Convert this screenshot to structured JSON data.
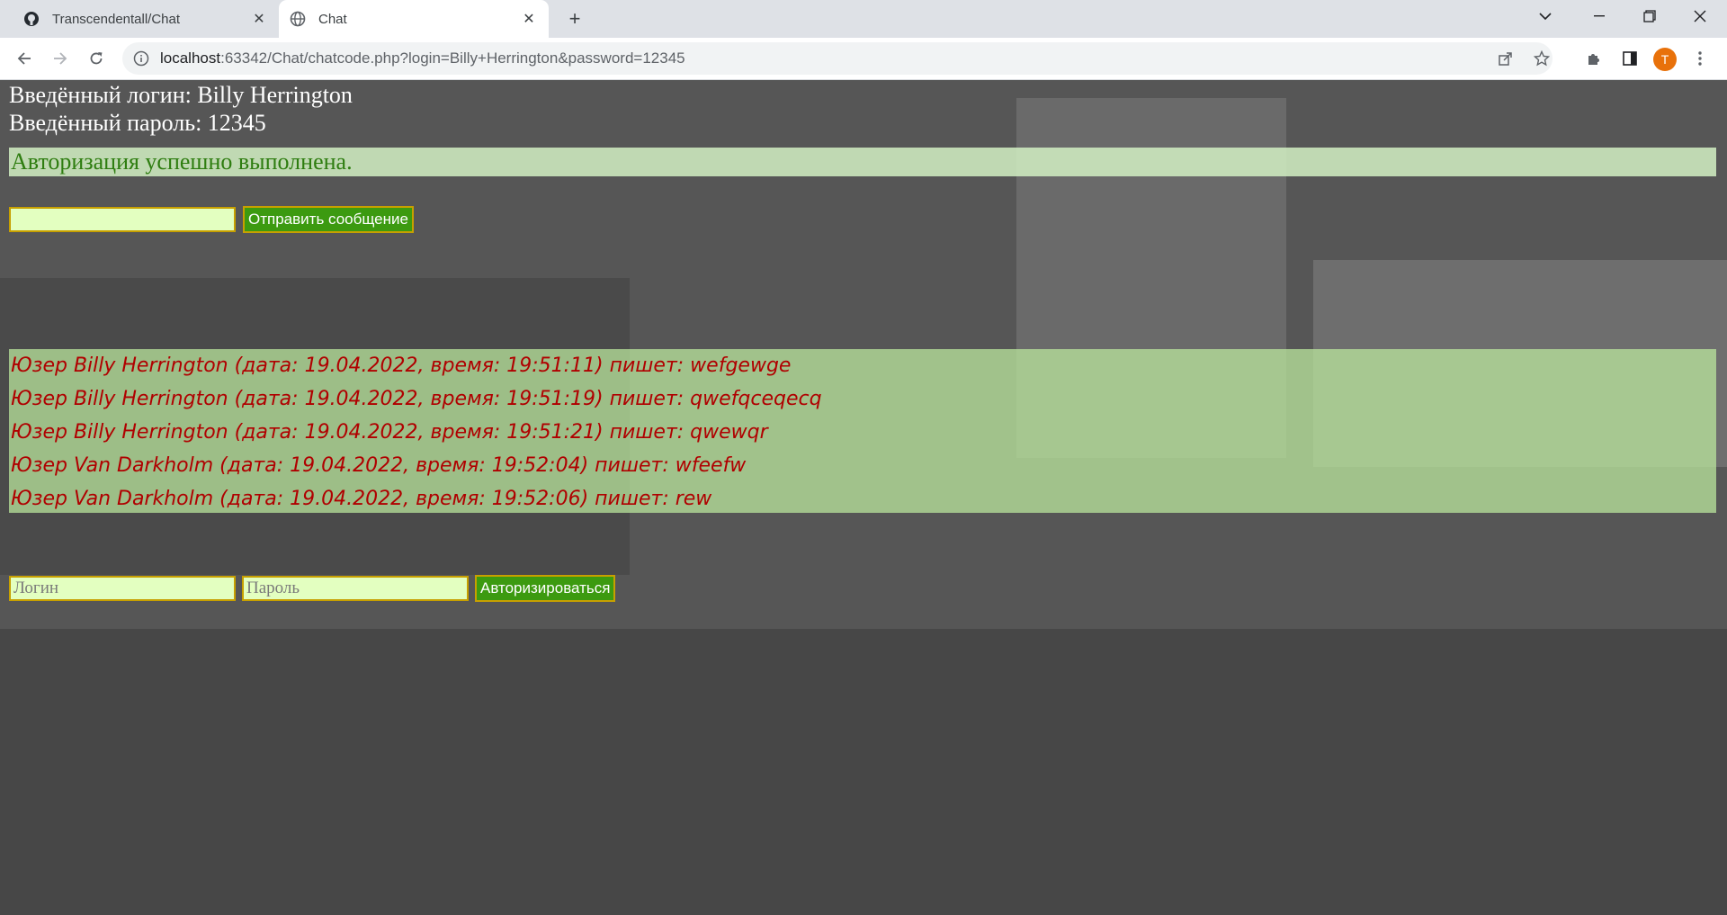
{
  "browser": {
    "tabs": [
      {
        "label": "Transcendentall/Chat",
        "icon": "github-icon",
        "active": false
      },
      {
        "label": "Chat",
        "icon": "globe-icon",
        "active": true
      }
    ],
    "url_host": "localhost",
    "url_rest": ":63342/Chat/chatcode.php?login=Billy+Herrington&password=12345",
    "profile_initial": "T",
    "colors": {
      "tabbar": "#dee1e6",
      "avatar": "#e8710a"
    }
  },
  "page": {
    "entered_login": "Введённый логин: Billy Herrington",
    "entered_password": "Введённый пароль: 12345",
    "auth_success": "Авторизация успешно выполнена.",
    "message_form": {
      "value": "",
      "send_label": "Отправить сообщение"
    },
    "messages": [
      "Юзер Billy Herrington (дата: 19.04.2022, время: 19:51:11) пишет: wefgewge",
      "Юзер Billy Herrington (дата: 19.04.2022, время: 19:51:19) пишет: qwefqceqecq",
      "Юзер Billy Herrington (дата: 19.04.2022, время: 19:51:21) пишет: qwewqr",
      "Юзер Van Darkholm (дата: 19.04.2022, время: 19:52:04) пишет: wfeefw",
      "Юзер Van Darkholm (дата: 19.04.2022, время: 19:52:06) пишет: rew"
    ],
    "login_form": {
      "login_placeholder": "Логин",
      "password_placeholder": "Пароль",
      "submit_label": "Авторизироваться"
    },
    "colors": {
      "success_text": "#2e7d10",
      "message_text": "#b00000",
      "input_bg": "#e3ffc0",
      "button_bg": "#3c9a10",
      "border": "#c7a000"
    }
  }
}
